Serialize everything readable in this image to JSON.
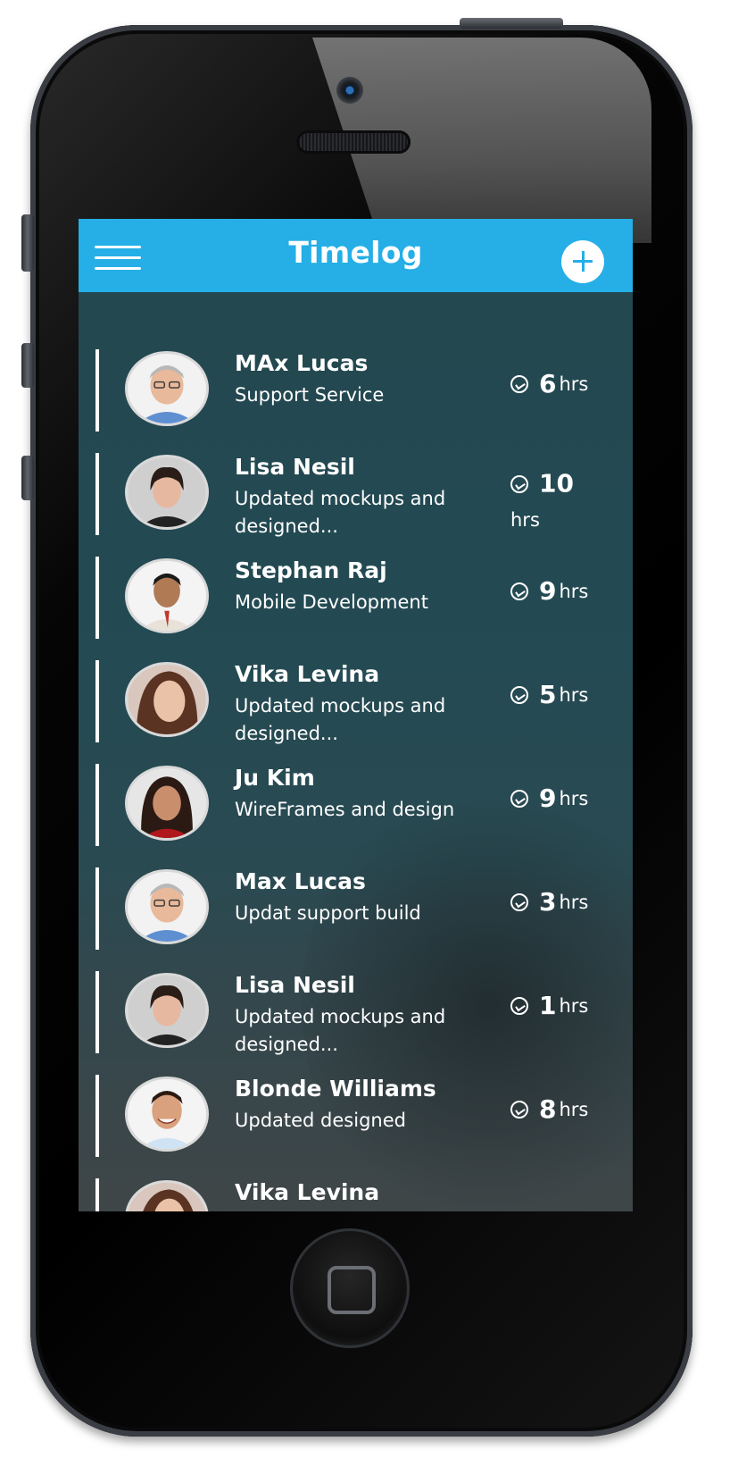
{
  "app": {
    "title": "Timelog",
    "header_icons": {
      "menu": "hamburger-menu-icon",
      "add": "plus-circle-icon"
    },
    "accent_color": "#25afe6"
  },
  "entries": [
    {
      "name": "MAx Lucas",
      "description": "Support Service",
      "hours": "6",
      "unit": "hrs",
      "avatar": "older-man-glasses"
    },
    {
      "name": "Lisa Nesil",
      "description": "Updated mockups and designed...",
      "hours": "10",
      "unit": "hrs",
      "avatar": "woman-dark-hair"
    },
    {
      "name": "Stephan Raj",
      "description": "Mobile Development",
      "hours": "9",
      "unit": "hrs",
      "avatar": "man-suit"
    },
    {
      "name": "Vika Levina",
      "description": "Updated mockups and designed...",
      "hours": "5",
      "unit": "hrs",
      "avatar": "woman-brunette"
    },
    {
      "name": "Ju Kim",
      "description": "WireFrames and design",
      "hours": "9",
      "unit": "hrs",
      "avatar": "woman-smiling-red"
    },
    {
      "name": "Max Lucas",
      "description": "Updat support build",
      "hours": "3",
      "unit": "hrs",
      "avatar": "older-man-glasses"
    },
    {
      "name": "Lisa Nesil",
      "description": "Updated mockups and designed...",
      "hours": "1",
      "unit": "hrs",
      "avatar": "woman-dark-hair"
    },
    {
      "name": "Blonde Williams",
      "description": "Updated designed",
      "hours": "8",
      "unit": "hrs",
      "avatar": "young-man-smiling"
    },
    {
      "name": "Vika Levina",
      "description": "",
      "hours": "",
      "unit": "",
      "avatar": "woman-brunette"
    }
  ]
}
